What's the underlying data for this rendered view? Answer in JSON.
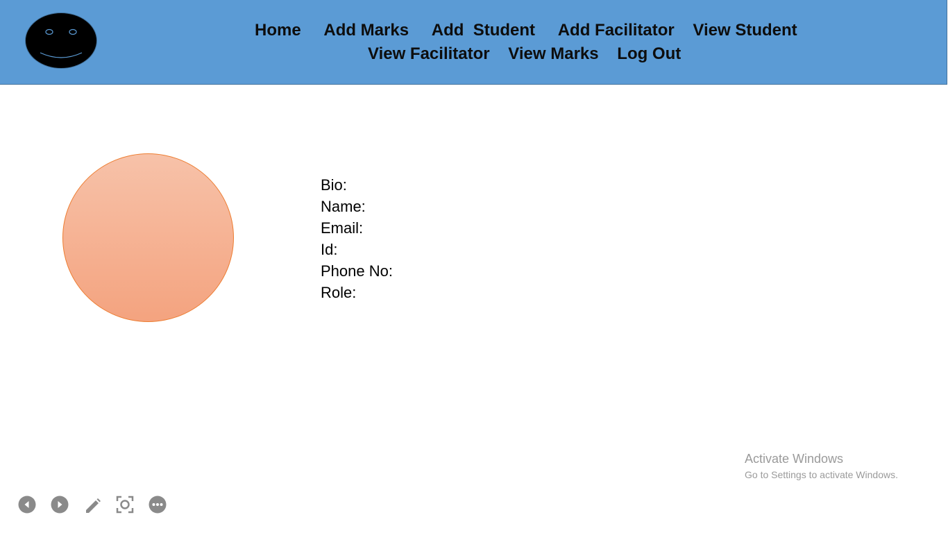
{
  "nav": {
    "row1": [
      "Home",
      "Add Marks",
      "Add  Student",
      "Add Facilitator",
      "View Student"
    ],
    "row2": [
      "View Facilitator",
      "View Marks",
      "Log Out"
    ]
  },
  "profile": {
    "bio_label": "Bio:",
    "name_label": "Name:",
    "email_label": "Email:",
    "id_label": "Id:",
    "phone_label": "Phone No:",
    "role_label": "Role:"
  },
  "watermark": {
    "title": "Activate Windows",
    "subtitle": "Go to Settings to activate Windows."
  },
  "controls": {
    "icons": [
      "previous-slide-icon",
      "next-slide-icon",
      "pen-icon",
      "zoom-icon",
      "more-options-icon"
    ]
  },
  "colors": {
    "header": "#5b9bd5",
    "avatar_fill_top": "#f7c2a9",
    "avatar_fill_bottom": "#f4a37f",
    "avatar_border": "#ed7d31",
    "logo": "#000000"
  }
}
